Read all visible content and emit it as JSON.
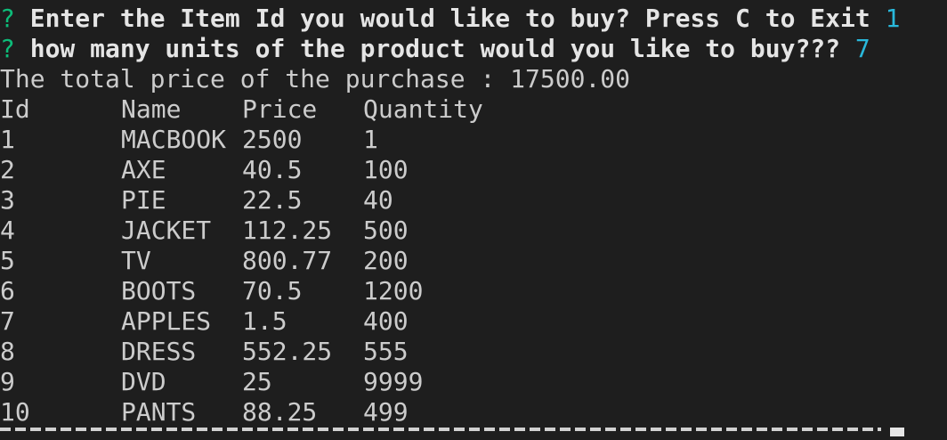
{
  "terminal": {
    "prompt1": {
      "mark": "?",
      "question": "Enter the Item Id you would like to buy? Press C to Exit",
      "answer": "1"
    },
    "prompt2": {
      "mark": "?",
      "question": "how many units of the product would you like to buy???",
      "answer": "7"
    },
    "total_line": "The total price of the purchase : 17500.00",
    "table": {
      "headers": [
        "Id",
        "Name",
        "Price",
        "Quantity"
      ],
      "rows": [
        [
          "1",
          "MACBOOK",
          "2500",
          "1"
        ],
        [
          "2",
          "AXE",
          "40.5",
          "100"
        ],
        [
          "3",
          "PIE",
          "22.5",
          "40"
        ],
        [
          "4",
          "JACKET",
          "112.25",
          "500"
        ],
        [
          "5",
          "TV",
          "800.77",
          "200"
        ],
        [
          "6",
          "BOOTS",
          "70.5",
          "1200"
        ],
        [
          "7",
          "APPLES",
          "1.5",
          "400"
        ],
        [
          "8",
          "DRESS",
          "552.25",
          "555"
        ],
        [
          "9",
          "DVD",
          "25",
          "9999"
        ],
        [
          "10",
          "PANTS",
          "88.25",
          "499"
        ]
      ]
    },
    "colors": {
      "background": "#1e1e1e",
      "prompt_mark": "#0dbc79",
      "answer": "#29b8db",
      "text": "#cccccc",
      "bold_text": "#e5e5e5"
    }
  }
}
